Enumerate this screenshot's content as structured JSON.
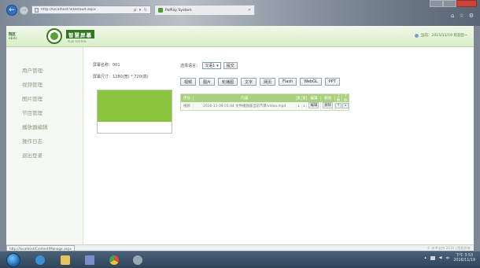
{
  "browser": {
    "address_url": "http://localhost:9/Default.aspx",
    "address_tools": "ρ ▾ ↻",
    "tab_title": "PoPlay System",
    "tab_close": "×"
  },
  "header": {
    "logo_line1": "院区",
    "logo_line2": "ebdc",
    "brand": "智慧屏幕",
    "brand_sub": "PLAY SYSTEM",
    "user_info": "当前：2015/11/19 欢迎您~"
  },
  "sidebar": {
    "items": [
      {
        "label": "用户管理"
      },
      {
        "label": "视频管理"
      },
      {
        "label": "图片管理"
      },
      {
        "label": "节目管理"
      },
      {
        "label": "播放器编辑"
      },
      {
        "label": "操作日志"
      },
      {
        "label": "退出登录"
      }
    ]
  },
  "main": {
    "screen_name": "屏幕名称：001",
    "screen_size": "屏幕尺寸：1280(宽) * 720(高)",
    "mode_label": "选择语言：",
    "mode_value": "汉语1",
    "mode_button": "提交",
    "type_buttons": [
      "视频",
      "图片",
      "轮播图",
      "文字",
      "网页",
      "Flash",
      "WebGL",
      "PPT"
    ],
    "grid": {
      "headers": [
        "序号",
        "内容",
        "类",
        "宽",
        "编辑",
        "删除",
        "上移",
        "下移"
      ],
      "rows": [
        {
          "seq": "视频",
          "content": "2016-11-09 01:44 文件播放器当前节目/video.mp4",
          "a": "1",
          "b": "1",
          "edit": "编辑",
          "del": "删除",
          "up": "↑",
          "down": "↓"
        }
      ]
    }
  },
  "status": {
    "url": "http://localhost/Content/Manage.aspx",
    "right": "© 技术支持 2016 | 版权所有"
  },
  "taskbar": {
    "time": "下午 3:53",
    "date": "2016/11/19"
  },
  "colors": {
    "accent_green": "#8bc43f",
    "header_green": "#a9d17d",
    "brand_green": "#2f7a1e"
  }
}
